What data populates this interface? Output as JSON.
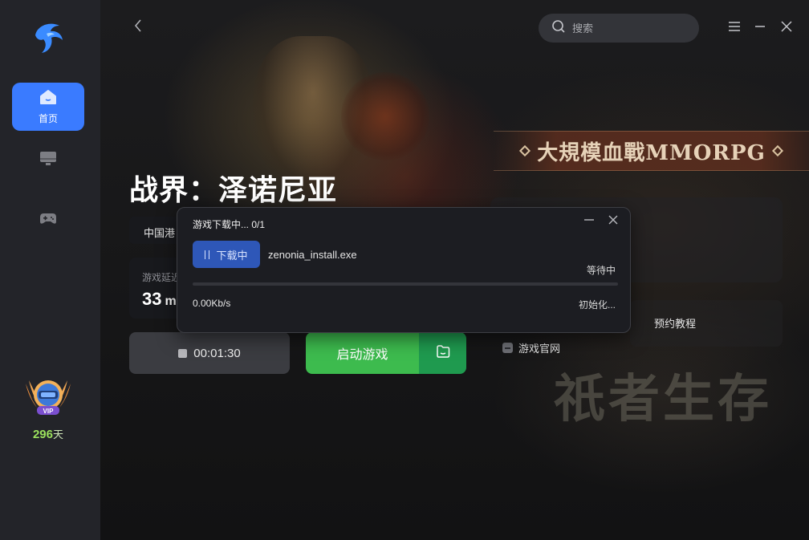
{
  "sidebar": {
    "home_label": "首页",
    "vip": {
      "badge": "VIP",
      "days": "296",
      "days_unit": "天"
    }
  },
  "header": {
    "search_placeholder": "搜索"
  },
  "game": {
    "title": "战界：泽诺尼亚",
    "server": "中国港",
    "latency_label": "游戏延迟",
    "latency_value": "33",
    "latency_unit": "m",
    "banner_text": "大規模血戰MMORPG",
    "bg_calligraphy": "祇者生存"
  },
  "actions": {
    "timer": "00:01:30",
    "start_label": "启动游戏",
    "tutorial_link": "预约教程",
    "official_link": "游戏官网"
  },
  "download_dialog": {
    "title": "游戏下载中... 0/1",
    "button_label": "下载中",
    "filename": "zenonia_install.exe",
    "status": "等待中",
    "progress_fraction": 0.0,
    "speed": "0.00Kb/s",
    "phase": "初始化..."
  },
  "colors": {
    "accent": "#3a7bff",
    "start_green": "#3dbb4e",
    "vip_days": "#9be15d"
  }
}
